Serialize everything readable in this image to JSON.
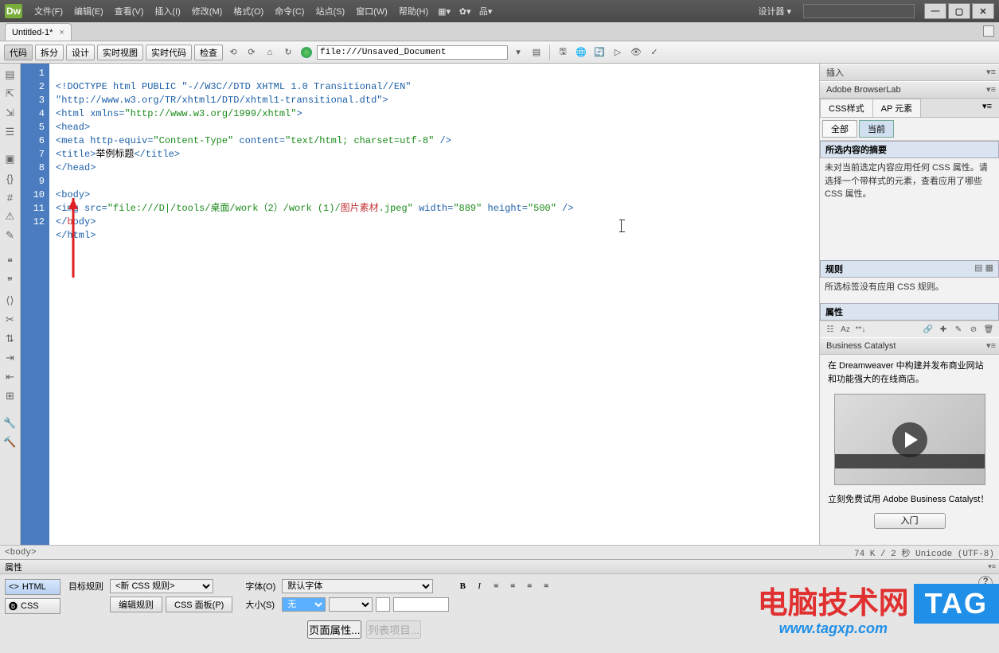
{
  "logo": "Dw",
  "menu": {
    "file": "文件(F)",
    "edit": "编辑(E)",
    "view": "查看(V)",
    "insert": "插入(I)",
    "modify": "修改(M)",
    "format": "格式(O)",
    "commands": "命令(C)",
    "site": "站点(S)",
    "window": "窗口(W)",
    "help": "帮助(H)"
  },
  "workspace": "设计器",
  "tab": {
    "name": "Untitled-1*",
    "close": "×"
  },
  "toolbar": {
    "code": "代码",
    "split": "拆分",
    "design": "设计",
    "live": "实时视图",
    "livecode": "实时代码",
    "inspect": "检查",
    "address": "file:///Unsaved_Document"
  },
  "lines": [
    "1",
    "2",
    "3",
    "4",
    "5",
    "6",
    "7",
    "8",
    "9",
    "10",
    "11",
    "12"
  ],
  "code": {
    "l1": "<!DOCTYPE html PUBLIC \"-//W3C//DTD XHTML 1.0 Transitional//EN\"",
    "l2": "\"http://www.w3.org/TR/xhtml1/DTD/xhtml1-transitional.dtd\">",
    "l3a": "<html xmlns=",
    "l3b": "\"http://www.w3.org/1999/xhtml\"",
    "l3c": ">",
    "l4": "<head>",
    "l5a": "<meta http-equiv=",
    "l5b": "\"Content-Type\"",
    "l5c": " content=",
    "l5d": "\"text/html; charset=utf-8\"",
    "l5e": " />",
    "l6a": "<title>",
    "l6b": "举例标题",
    "l6c": "</title>",
    "l7": "</head>",
    "l8": "",
    "l9": "<body>",
    "l10a": "<img src=",
    "l10b": "\"file:///D|/tools/桌面/work（2）/work (1)/",
    "l10c": "图片素材",
    "l10d": ".jpeg\"",
    "l10e": " width=",
    "l10f": "\"889\"",
    "l10g": " height=",
    "l10h": "\"500\"",
    "l10i": " />",
    "l11a": "</",
    "l11b": "b",
    "l11c": "ody>",
    "l12": "</html>"
  },
  "status": {
    "path": "<body>",
    "info": "74 K / 2 秒 Unicode (UTF-8)"
  },
  "props": {
    "title": "属性",
    "btn_html": "HTML",
    "btn_css": "CSS",
    "target_rule": "目标规则",
    "target_rule_val": "<新 CSS 规则>",
    "edit_rule": "编辑规则",
    "css_panel": "CSS 面板(P)",
    "font": "字体(O)",
    "font_val": "默认字体",
    "size": "大小(S)",
    "size_val": "无",
    "page_props": "页面属性...",
    "list_items": "列表项目..."
  },
  "right": {
    "insert": "插入",
    "browserlab": "Adobe BrowserLab",
    "css_styles": "CSS样式",
    "ap_elem": "AP 元素",
    "all": "全部",
    "current": "当前",
    "summary_hdr": "所选内容的摘要",
    "summary_body": "未对当前选定内容应用任何 CSS 属性。请选择一个带样式的元素，查看应用了哪些 CSS 属性。",
    "rules": "规则",
    "rules_body": "所选标签没有应用 CSS 规则。",
    "properties": "属性",
    "bc": "Business Catalyst",
    "bc_text": "在 Dreamweaver 中构建并发布商业网站和功能强大的在线商店。",
    "bc_try": "立刻免费试用 Adobe Business Catalyst！",
    "bc_btn": "入门"
  },
  "watermark": {
    "text": "电脑技术网",
    "tag": "TAG",
    "url": "www.tagxp.com"
  }
}
